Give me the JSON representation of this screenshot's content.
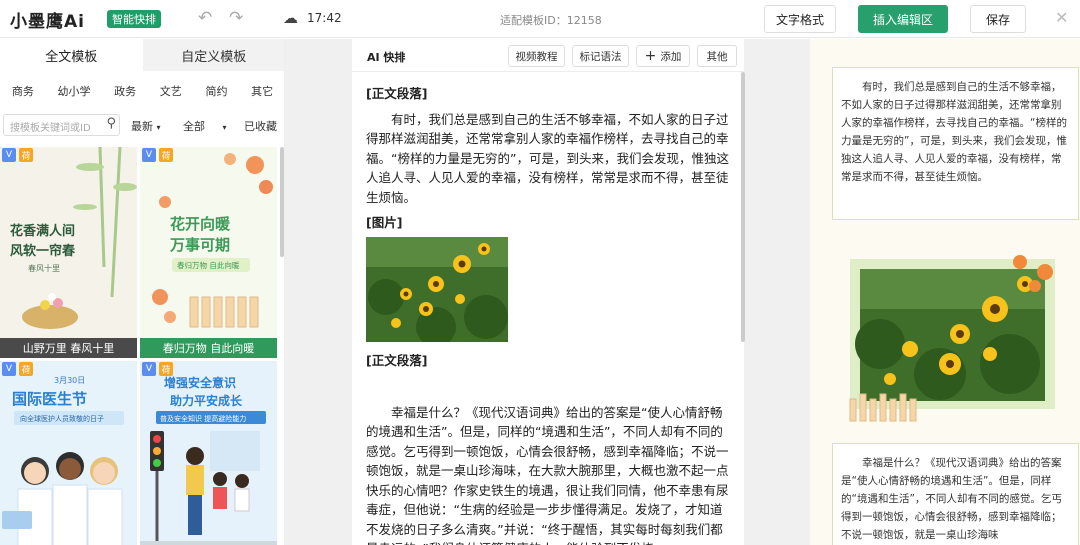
{
  "header": {
    "logo_text": "小墨鹰Ai",
    "logo_badge": "智能快排",
    "save_time": "17:42",
    "template_id": "适配模板ID：12158",
    "text_format_label": "文字格式",
    "insert_label": "插入编辑区",
    "save_label": "保存"
  },
  "left": {
    "tabs": [
      "全文模板",
      "自定义模板"
    ],
    "categories": [
      "商务",
      "幼小学",
      "政务",
      "文艺",
      "简约",
      "其它"
    ],
    "search_placeholder": "搜模板关键词或ID",
    "sort_label": "最新",
    "filter_label": "全部",
    "collected_label": "已收藏",
    "cards": [
      {
        "title": "花香满人间",
        "subtitle": "风软一帘春",
        "tag": "春风十里",
        "caption": "山野万里 春风十里",
        "caption_color": "#4a4a4a"
      },
      {
        "title": "花开向暖",
        "subtitle": "万事可期",
        "tag": "春归万物 自此向暖",
        "caption": "春归万物 自此向暖",
        "caption_color": "#2f9a5c"
      },
      {
        "title": "国际医生节",
        "date": "3月30日",
        "subtitle": "向全球医护人员致敬的日子"
      },
      {
        "title": "增强安全意识",
        "subtitle": "助力平安成长",
        "tag": "普及安全知识 提高避险能力"
      }
    ],
    "badge_v": "V",
    "badge_p": "荷"
  },
  "editor": {
    "ai_label": "AI 快排",
    "buttons": {
      "video": "视频教程",
      "markup": "标记语法",
      "add": "添加",
      "other": "其他"
    },
    "sections": [
      {
        "kind": "heading",
        "text": "[正文段落]"
      },
      {
        "kind": "para",
        "text": "有时，我们总是感到自己的生活不够幸福，不如人家的日子过得那样滋润甜美，还常常拿别人家的幸福作榜样，去寻找自己的幸福。“榜样的力量是无穷的”，可是，到头来，我们会发现，惟独这人追人寻、人见人爱的幸福，没有榜样，常常是求而不得，甚至徒生烦恼。"
      },
      {
        "kind": "heading",
        "text": "[图片]"
      },
      {
        "kind": "image",
        "text": ""
      },
      {
        "kind": "heading",
        "text": "[正文段落]"
      },
      {
        "kind": "para",
        "text": "幸福是什么？《现代汉语词典》给出的答案是“使人心情舒畅的境遇和生活”。但是，同样的“境遇和生活”，不同人却有不同的感觉。乞丐得到一顿饱饭，心情会很舒畅，感到幸福降临；不说一顿饱饭，就是一桌山珍海味，在大款大腕那里，大概也激不起一点快乐的心情吧？作家史铁生的境遇，很让我们同情，他不幸患有尿毒症，但他说：“生病的经验是一步步懂得满足。发烧了，才知道不发烧的日子多么清爽。”并说：“终于醒悟，其实每时每刻我们都是幸运的。”我们身体还算健康的人，能体验到不发烧，"
      }
    ]
  },
  "preview": {
    "para1": "有时，我们总是感到自己的生活不够幸福，不如人家的日子过得那样滋润甜美，还常常拿别人家的幸福作榜样，去寻找自己的幸福。“榜样的力量是无穷的”，可是，到头来，我们会发现，惟独这人追人寻、人见人爱的幸福，没有榜样，常常是求而不得，甚至徒生烦恼。",
    "para2": "幸福是什么？《现代汉语词典》给出的答案是“使人心情舒畅的境遇和生活”。但是，同样的“境遇和生活”，不同人却有不同的感觉。乞丐得到一顿饱饭，心情会很舒畅，感到幸福降临；不说一顿饱饭，就是一桌山珍海味"
  },
  "colors": {
    "brand_green": "#27a06e",
    "accent_orange": "#f08a3a"
  },
  "icons": [
    "undo-icon",
    "redo-icon",
    "cloud-icon",
    "search-icon",
    "plus-icon",
    "close-icon",
    "chevron-down-icon"
  ]
}
